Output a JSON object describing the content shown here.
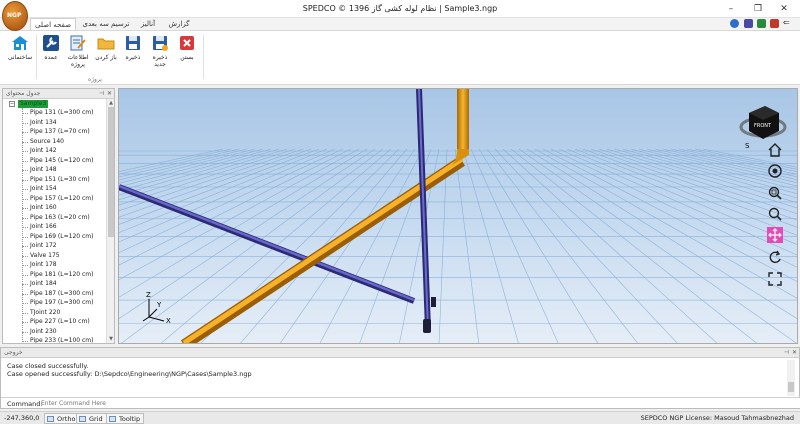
{
  "window": {
    "title": "SPEDCO © 1396   نظام لوله کشی گاز | Sample3.ngp",
    "minimize": "–",
    "maximize": "❐",
    "close": "✕",
    "back_arrow": "⇐"
  },
  "ribbon": {
    "tabs": [
      {
        "label": "صفحه اصلی"
      },
      {
        "label": "ترسیم سه بعدی"
      },
      {
        "label": "آنالیز"
      },
      {
        "label": "گزارش"
      }
    ],
    "buttons": [
      {
        "label": "ساختمانی",
        "color": "#1a8fd1"
      },
      {
        "label": "عمده",
        "color": "#1f4f8f"
      },
      {
        "label": "اطلاعات پروژه",
        "color": "#3a6eb8"
      },
      {
        "label": "باز کردن",
        "color": "#e0a020"
      },
      {
        "label": "ذخیره",
        "color": "#2a5da6"
      },
      {
        "label": "ذخیره جدید",
        "color": "#2a5da6"
      },
      {
        "label": "بستن",
        "color": "#d83a3a"
      }
    ],
    "group_label": "پروژه"
  },
  "tree": {
    "header": "جدول محتوای",
    "root_label": "Sample3",
    "items": [
      "Pipe 131 (L=300 cm)",
      "Joint 134",
      "Pipe 137 (L=70 cm)",
      "Source 140",
      "Joint 142",
      "Pipe 145 (L=120 cm)",
      "Joint 148",
      "Pipe 151 (L=30 cm)",
      "Joint 154",
      "Pipe 157 (L=120 cm)",
      "Joint 160",
      "Pipe 163 (L=20 cm)",
      "Joint 166",
      "Pipe 169 (L=120 cm)",
      "Joint 172",
      "Valve 175",
      "Joint 178",
      "Pipe 181 (L=120 cm)",
      "Joint 184",
      "Pipe 187 (L=300 cm)",
      "Pipe 197 (L=300 cm)",
      "TJoint 220",
      "Pipe 227 (L=10 cm)",
      "Joint 230",
      "Pipe 233 (L=100 cm)"
    ]
  },
  "viewport": {
    "cube_label": "FRONT",
    "axis_labels": {
      "x": "X",
      "y": "Y",
      "z": "Z"
    },
    "compass_label": "S",
    "colors": {
      "bg_top": "#a8c6e6",
      "bg_bottom": "#e6eef7",
      "pipe_orange": "#f2a71b",
      "pipe_blue": "#4a49a6",
      "tool_active": "#e34cb6"
    }
  },
  "output": {
    "header": "خروجی",
    "lines": [
      "Case closed successfully.",
      "Case opened successfully: D:\\Sepdco\\Engineering\\NGP\\Cases\\Sample3.ngp"
    ],
    "command_label": "Command:",
    "command_placeholder": "Enter Command Here"
  },
  "status": {
    "coord": "-247,360,0",
    "ortho": "Ortho",
    "grid": "Grid",
    "tooltip": "Tooltip",
    "license": "SEPDCO NGP License:  Masoud Tahmasbnezhad"
  }
}
